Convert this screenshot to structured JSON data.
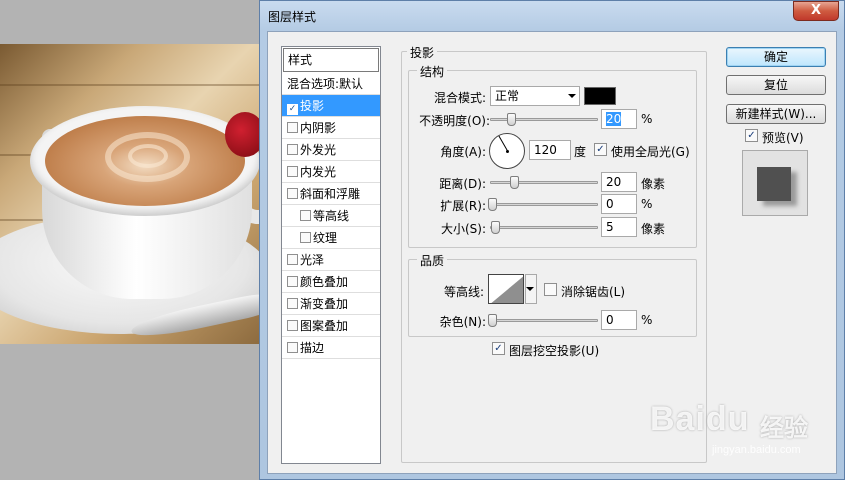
{
  "window": {
    "title": "图层样式",
    "close_label": "X"
  },
  "styles_panel": {
    "header": "样式",
    "items": [
      {
        "label": "混合选项:默认",
        "checkbox": false,
        "checked": false,
        "selected": false,
        "indent": false
      },
      {
        "label": "投影",
        "checkbox": true,
        "checked": true,
        "selected": true,
        "indent": false
      },
      {
        "label": "内阴影",
        "checkbox": true,
        "checked": false,
        "selected": false,
        "indent": false
      },
      {
        "label": "外发光",
        "checkbox": true,
        "checked": false,
        "selected": false,
        "indent": false
      },
      {
        "label": "内发光",
        "checkbox": true,
        "checked": false,
        "selected": false,
        "indent": false
      },
      {
        "label": "斜面和浮雕",
        "checkbox": true,
        "checked": false,
        "selected": false,
        "indent": false
      },
      {
        "label": "等高线",
        "checkbox": true,
        "checked": false,
        "selected": false,
        "indent": true
      },
      {
        "label": "纹理",
        "checkbox": true,
        "checked": false,
        "selected": false,
        "indent": true
      },
      {
        "label": "光泽",
        "checkbox": true,
        "checked": false,
        "selected": false,
        "indent": false
      },
      {
        "label": "颜色叠加",
        "checkbox": true,
        "checked": false,
        "selected": false,
        "indent": false
      },
      {
        "label": "渐变叠加",
        "checkbox": true,
        "checked": false,
        "selected": false,
        "indent": false
      },
      {
        "label": "图案叠加",
        "checkbox": true,
        "checked": false,
        "selected": false,
        "indent": false
      },
      {
        "label": "描边",
        "checkbox": true,
        "checked": false,
        "selected": false,
        "indent": false
      }
    ]
  },
  "drop_shadow": {
    "section_title": "投影",
    "structure": {
      "title": "结构",
      "blend_mode_label": "混合模式:",
      "blend_mode_value": "正常",
      "blend_color": "#000000",
      "opacity_label": "不透明度(O):",
      "opacity_value": "20",
      "opacity_unit": "%",
      "angle_label": "角度(A):",
      "angle_value": "120",
      "angle_unit": "度",
      "global_light_label": "使用全局光(G)",
      "global_light_checked": true,
      "distance_label": "距离(D):",
      "distance_value": "20",
      "distance_unit": "像素",
      "spread_label": "扩展(R):",
      "spread_value": "0",
      "spread_unit": "%",
      "size_label": "大小(S):",
      "size_value": "5",
      "size_unit": "像素"
    },
    "quality": {
      "title": "品质",
      "contour_label": "等高线:",
      "anti_alias_label": "消除锯齿(L)",
      "anti_alias_checked": false,
      "noise_label": "杂色(N):",
      "noise_value": "0",
      "noise_unit": "%"
    },
    "knockout_label": "图层挖空投影(U)",
    "knockout_checked": true
  },
  "buttons": {
    "ok": "确定",
    "reset": "复位",
    "new_style": "新建样式(W)...",
    "preview_label": "预览(V)",
    "preview_checked": true
  },
  "watermark": {
    "brand": "Baidu",
    "product": "经验",
    "url": "jingyan.baidu.com"
  },
  "check_mark": "✓"
}
